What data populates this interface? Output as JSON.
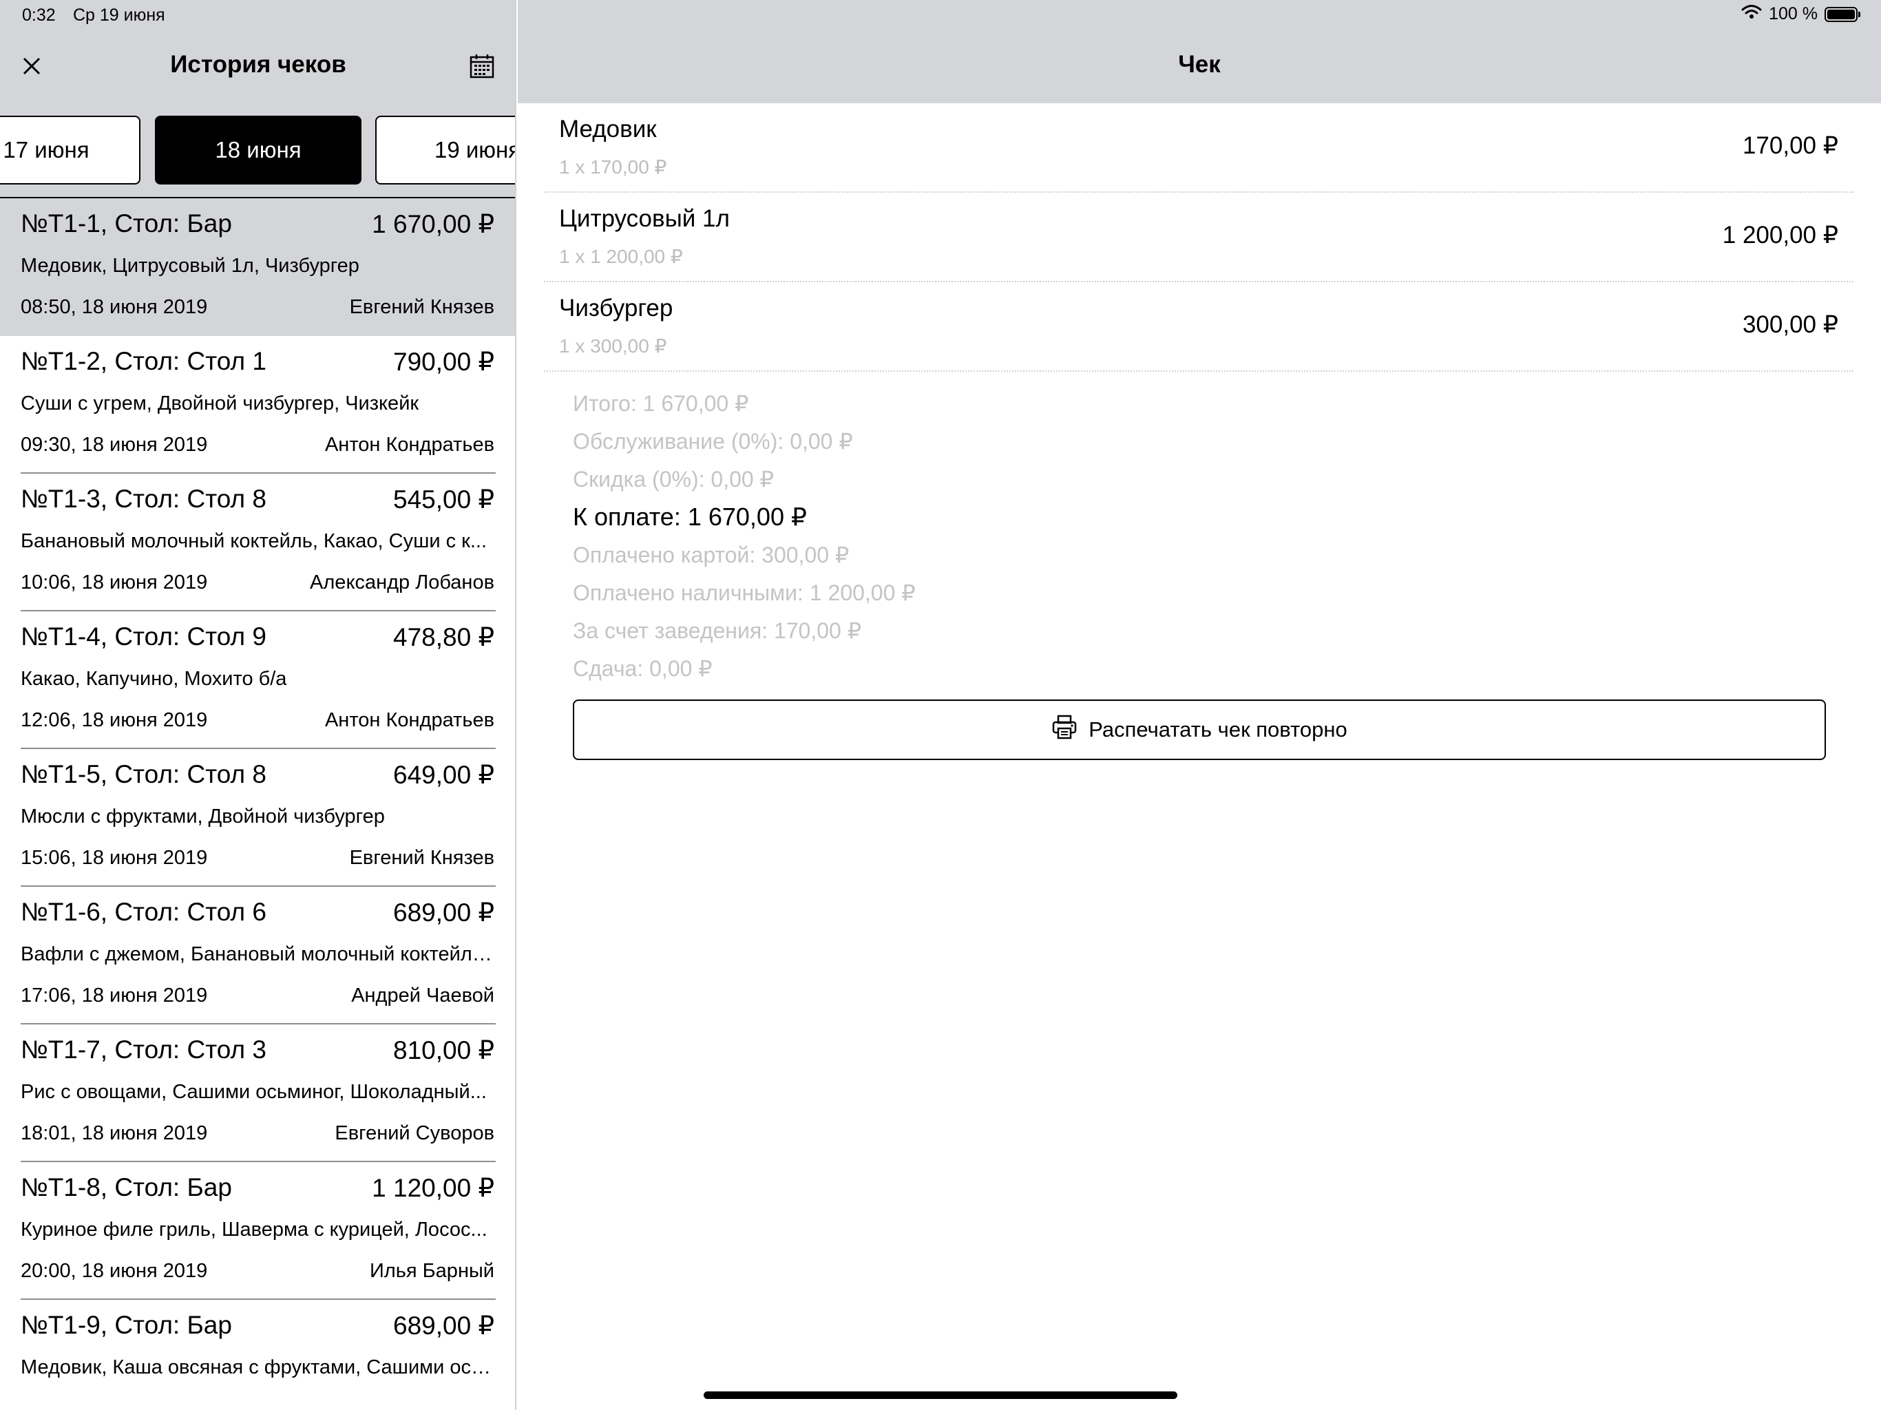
{
  "status": {
    "time": "0:32",
    "date": "Ср 19 июня",
    "battery": "100 %",
    "battery_level": 1.0
  },
  "history": {
    "title": "История чеков",
    "date_tabs": [
      "17 июня",
      "18 июня",
      "19 июня"
    ],
    "active_tab": 1,
    "receipts": [
      {
        "number": "№Т1-1, Стол: Бар",
        "sum": "1 670,00 ₽",
        "items": "Медовик, Цитрусовый 1л, Чизбургер",
        "time": "08:50, 18 июня 2019",
        "author": "Евгений Князев"
      },
      {
        "number": "№Т1-2, Стол: Стол 1",
        "sum": "790,00 ₽",
        "items": "Суши с угрем, Двойной чизбургер, Чизкейк",
        "time": "09:30, 18 июня 2019",
        "author": "Антон Кондратьев"
      },
      {
        "number": "№Т1-3, Стол: Стол 8",
        "sum": "545,00 ₽",
        "items": "Банановый молочный коктейль, Какао, Суши с к...",
        "time": "10:06, 18 июня 2019",
        "author": "Александр Лобанов"
      },
      {
        "number": "№Т1-4, Стол: Стол 9",
        "sum": "478,80 ₽",
        "items": "Какао, Капучино, Мохито б/а",
        "time": "12:06, 18 июня 2019",
        "author": "Антон Кондратьев"
      },
      {
        "number": "№Т1-5, Стол: Стол 8",
        "sum": "649,00 ₽",
        "items": "Мюсли с фруктами, Двойной чизбургер",
        "time": "15:06, 18 июня 2019",
        "author": "Евгений Князев"
      },
      {
        "number": "№Т1-6, Стол: Стол 6",
        "sum": "689,00 ₽",
        "items": "Вафли с джемом, Банановый молочный коктейль...",
        "time": "17:06, 18 июня 2019",
        "author": "Андрей Чаевой"
      },
      {
        "number": "№Т1-7, Стол: Стол 3",
        "sum": "810,00 ₽",
        "items": "Рис с овощами, Сашими осьминог, Шоколадный...",
        "time": "18:01, 18 июня 2019",
        "author": "Евгений Суворов"
      },
      {
        "number": "№Т1-8, Стол: Бар",
        "sum": "1 120,00 ₽",
        "items": "Куриное филе гриль, Шаверма с курицей, Лосос...",
        "time": "20:00, 18 июня 2019",
        "author": "Илья Барный"
      },
      {
        "number": "№Т1-9, Стол: Бар",
        "sum": "689,00 ₽",
        "items": "Медовик, Каша овсяная с фруктами, Сашими ось...",
        "time": "",
        "author": ""
      }
    ]
  },
  "receipt": {
    "title": "Чек",
    "lines": [
      {
        "name": "Медовик",
        "qty": "1 x 170,00 ₽",
        "sum": "170,00 ₽"
      },
      {
        "name": "Цитрусовый 1л",
        "qty": "1 x 1 200,00 ₽",
        "sum": "1 200,00 ₽"
      },
      {
        "name": "Чизбургер",
        "qty": "1 x 300,00 ₽",
        "sum": "300,00 ₽"
      }
    ],
    "totals": {
      "subtotal": "Итого: 1 670,00 ₽",
      "service": "Обслуживание (0%): 0,00 ₽",
      "discount": "Скидка (0%): 0,00 ₽",
      "to_pay": "К оплате: 1 670,00 ₽",
      "paid_card": "Оплачено картой: 300,00 ₽",
      "paid_cash": "Оплачено наличными: 1 200,00 ₽",
      "on_house": "За счет заведения: 170,00 ₽",
      "change": "Сдача: 0,00 ₽"
    },
    "reprint_label": "Распечатать чек повторно"
  },
  "icons": {
    "close": "close-icon",
    "calendar": "calendar-icon",
    "printer": "printer-icon",
    "wifi": "wifi-icon",
    "battery": "battery-icon"
  },
  "colors": {
    "header_bg": "#d4d5d8",
    "active_tab_bg": "#000000",
    "muted_text": "#c4c4c4"
  }
}
